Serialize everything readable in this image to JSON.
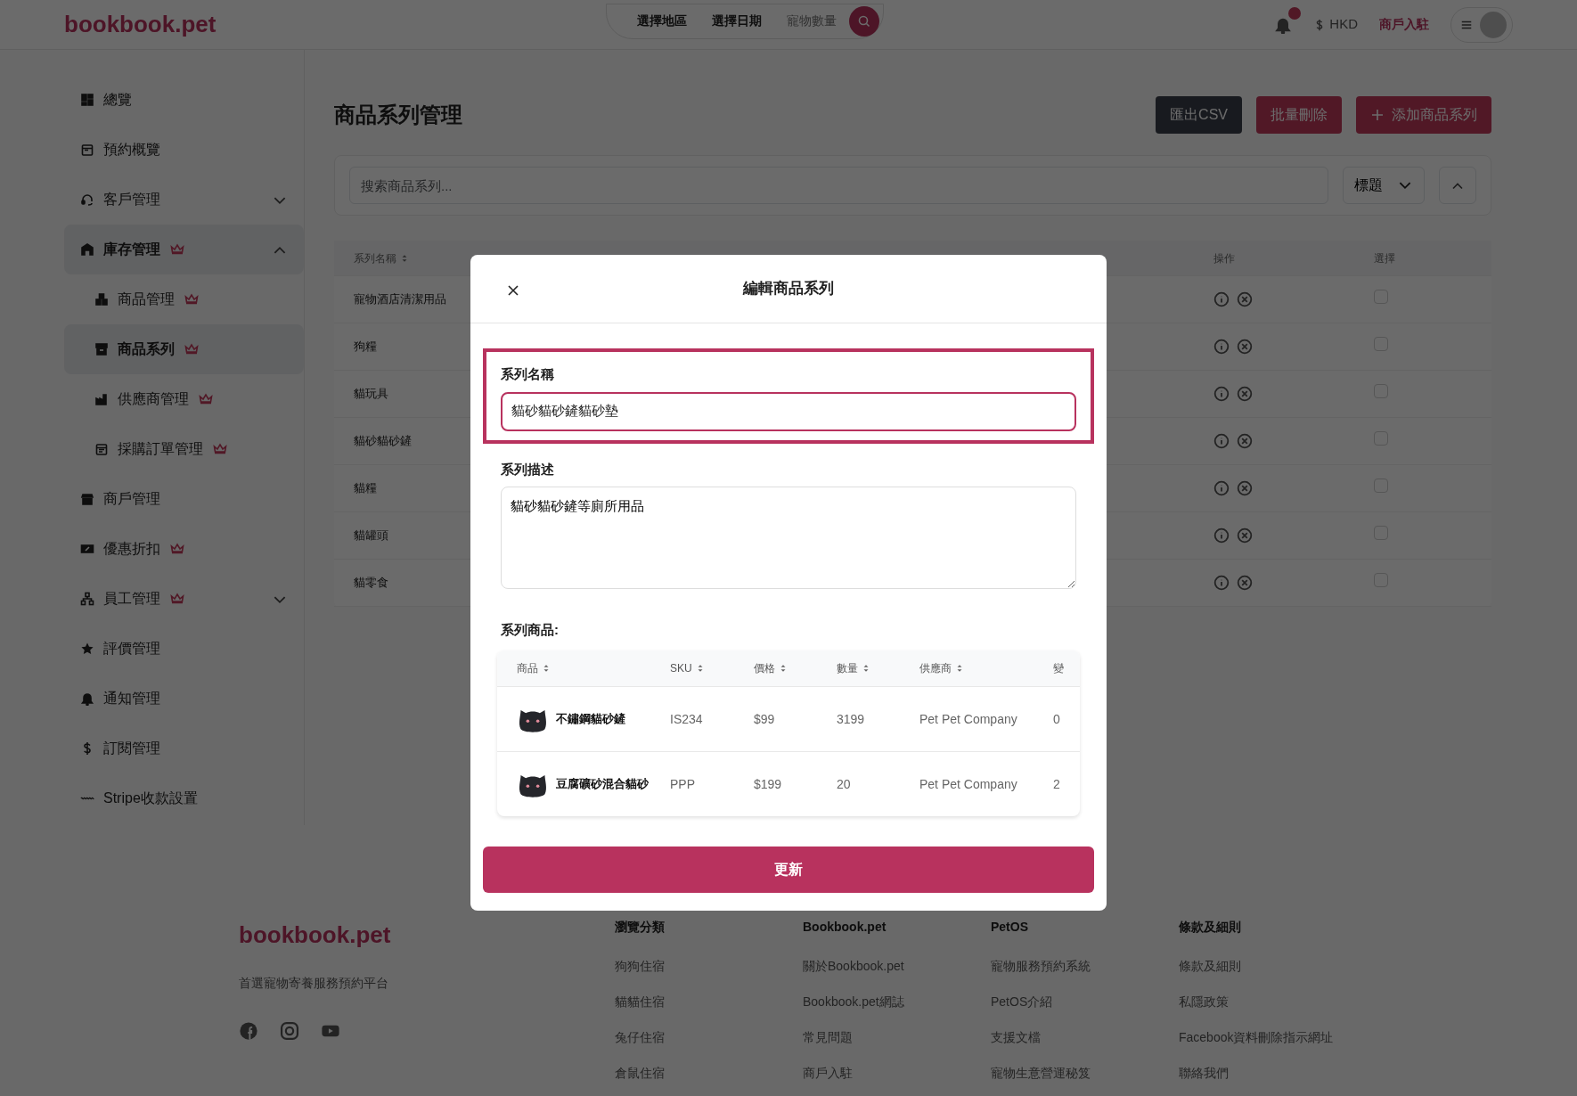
{
  "header": {
    "logo": "bookbook.pet",
    "search": {
      "location": "選擇地區",
      "date": "選擇日期",
      "pets": "寵物數量"
    },
    "currency": "HKD",
    "merchant_link": "商戶入駐"
  },
  "sidebar": {
    "items": [
      {
        "label": "總覽",
        "premium": false,
        "selected": false
      },
      {
        "label": "預約概覽",
        "premium": false,
        "selected": false
      },
      {
        "label": "客戶管理",
        "premium": false,
        "selected": false,
        "expanded": false
      },
      {
        "label": "庫存管理",
        "premium": true,
        "selected": true,
        "expanded": true,
        "children": [
          {
            "label": "商品管理",
            "premium": true,
            "selected": false
          },
          {
            "label": "商品系列",
            "premium": true,
            "selected": true
          },
          {
            "label": "供應商管理",
            "premium": true,
            "selected": false
          },
          {
            "label": "採購訂單管理",
            "premium": true,
            "selected": false
          }
        ]
      },
      {
        "label": "商戶管理",
        "premium": false,
        "selected": false
      },
      {
        "label": "優惠折扣",
        "premium": true,
        "selected": false
      },
      {
        "label": "員工管理",
        "premium": true,
        "selected": false,
        "expanded": false
      },
      {
        "label": "評價管理",
        "premium": false,
        "selected": false
      },
      {
        "label": "通知管理",
        "premium": false,
        "selected": false
      },
      {
        "label": "訂閱管理",
        "premium": false,
        "selected": false
      },
      {
        "label": "Stripe收款設置",
        "premium": false,
        "selected": false
      }
    ]
  },
  "page": {
    "title": "商品系列管理",
    "buttons": [
      {
        "label": "匯出CSV",
        "kind": "dark"
      },
      {
        "label": "批量刪除",
        "kind": "danger"
      },
      {
        "label": "添加商品系列",
        "kind": "add"
      }
    ],
    "search": {
      "placeholder": "搜索商品系列..."
    },
    "sort": {
      "value": "標題"
    },
    "table": {
      "columns": [
        "系列名稱",
        "操作",
        "選擇"
      ],
      "rows": [
        {
          "name": "寵物酒店清潔用品",
          "checked": false
        },
        {
          "name": "狗糧",
          "checked": false
        },
        {
          "name": "貓玩具",
          "checked": false
        },
        {
          "name": "貓砂貓砂鏟",
          "checked": false
        },
        {
          "name": "貓糧",
          "checked": false
        },
        {
          "name": "貓罐頭",
          "checked": false
        },
        {
          "name": "貓零食",
          "checked": false
        }
      ]
    }
  },
  "modal": {
    "title": "編輯商品系列",
    "fields": [
      {
        "label": "系列名稱",
        "value": "貓砂貓砂鏟貓砂墊",
        "kind": "input",
        "highlighted": true
      },
      {
        "label": "系列描述",
        "value": "貓砂貓砂鏟等廁所用品",
        "kind": "textarea",
        "highlighted": false
      }
    ],
    "products": {
      "label": "系列商品:",
      "columns": [
        "商品",
        "SKU",
        "價格",
        "數量",
        "供應商",
        "變"
      ],
      "rows": [
        {
          "name": "不鏽鋼貓砂鏟",
          "sku": "IS234",
          "price": "$99",
          "quantity": "3199",
          "supplier": "Pet Pet Company",
          "column_6": "0"
        },
        {
          "name": "豆腐礦砂混合貓砂",
          "sku": "PPP",
          "price": "$199",
          "quantity": "20",
          "supplier": "Pet Pet Company",
          "column_6": "2"
        }
      ]
    },
    "submit": "更新"
  },
  "footer": {
    "logo": "bookbook.pet",
    "tagline": "首選寵物寄養服務預約平台",
    "columns": [
      {
        "heading": "瀏覽分類",
        "links": [
          "狗狗住宿",
          "貓貓住宿",
          "兔仔住宿",
          "倉鼠住宿"
        ]
      },
      {
        "heading": "Bookbook.pet",
        "links": [
          "關於Bookbook.pet",
          "Bookbook.pet網誌",
          "常見問題",
          "商戶入駐"
        ]
      },
      {
        "heading": "PetOS",
        "links": [
          "寵物服務預約系統",
          "PetOS介紹",
          "支援文檔",
          "寵物生意營運秘笈"
        ]
      },
      {
        "heading": "條款及細則",
        "links": [
          "條款及細則",
          "私隱政策",
          "Facebook資料刪除指示網址",
          "聯絡我們"
        ]
      }
    ]
  }
}
